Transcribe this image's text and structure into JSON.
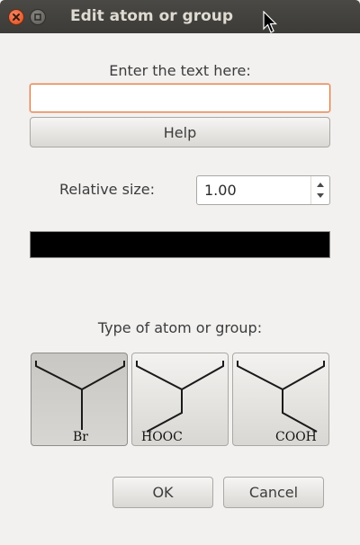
{
  "window": {
    "title": "Edit atom or group"
  },
  "dialog": {
    "prompt_label": "Enter the text here:",
    "text_value": "",
    "help_label": "Help",
    "size_label": "Relative size:",
    "size_value": "1.00",
    "color_value": "#000000",
    "type_label": "Type of atom or group:",
    "types": [
      {
        "label": "Br",
        "selected": true
      },
      {
        "label": "HOOC",
        "selected": false
      },
      {
        "label": "COOH",
        "selected": false
      }
    ],
    "ok_label": "OK",
    "cancel_label": "Cancel"
  }
}
